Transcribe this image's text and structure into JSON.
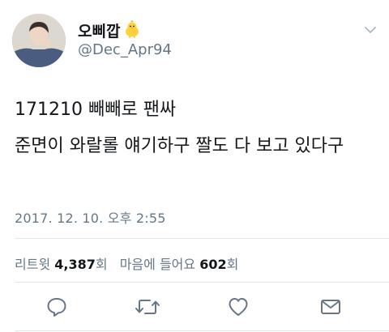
{
  "author": {
    "display_name": "오삐깝",
    "handle": "@Dec_Apr94",
    "name_emoji": "chick-emoji",
    "avatar": "user-avatar-photo"
  },
  "tweet": {
    "line1": "171210 빼빼로 팬싸",
    "line2": "준면이 와랄롤 얘기하구 짤도 다 보고 있다구",
    "timestamp": "2017. 12. 10. 오후 2:55"
  },
  "stats": {
    "retweet_label": "리트윗",
    "retweet_count": "4,387",
    "retweet_unit": "회",
    "like_label": "마음에 들어요",
    "like_count": "602",
    "like_unit": "회"
  },
  "actions": {
    "reply": "reply-icon",
    "retweet": "retweet-icon",
    "like": "heart-icon",
    "message": "envelope-icon",
    "more": "chevron-down-icon"
  },
  "colors": {
    "text": "#14171a",
    "secondary": "#657786",
    "divider": "#e1e8ed"
  }
}
